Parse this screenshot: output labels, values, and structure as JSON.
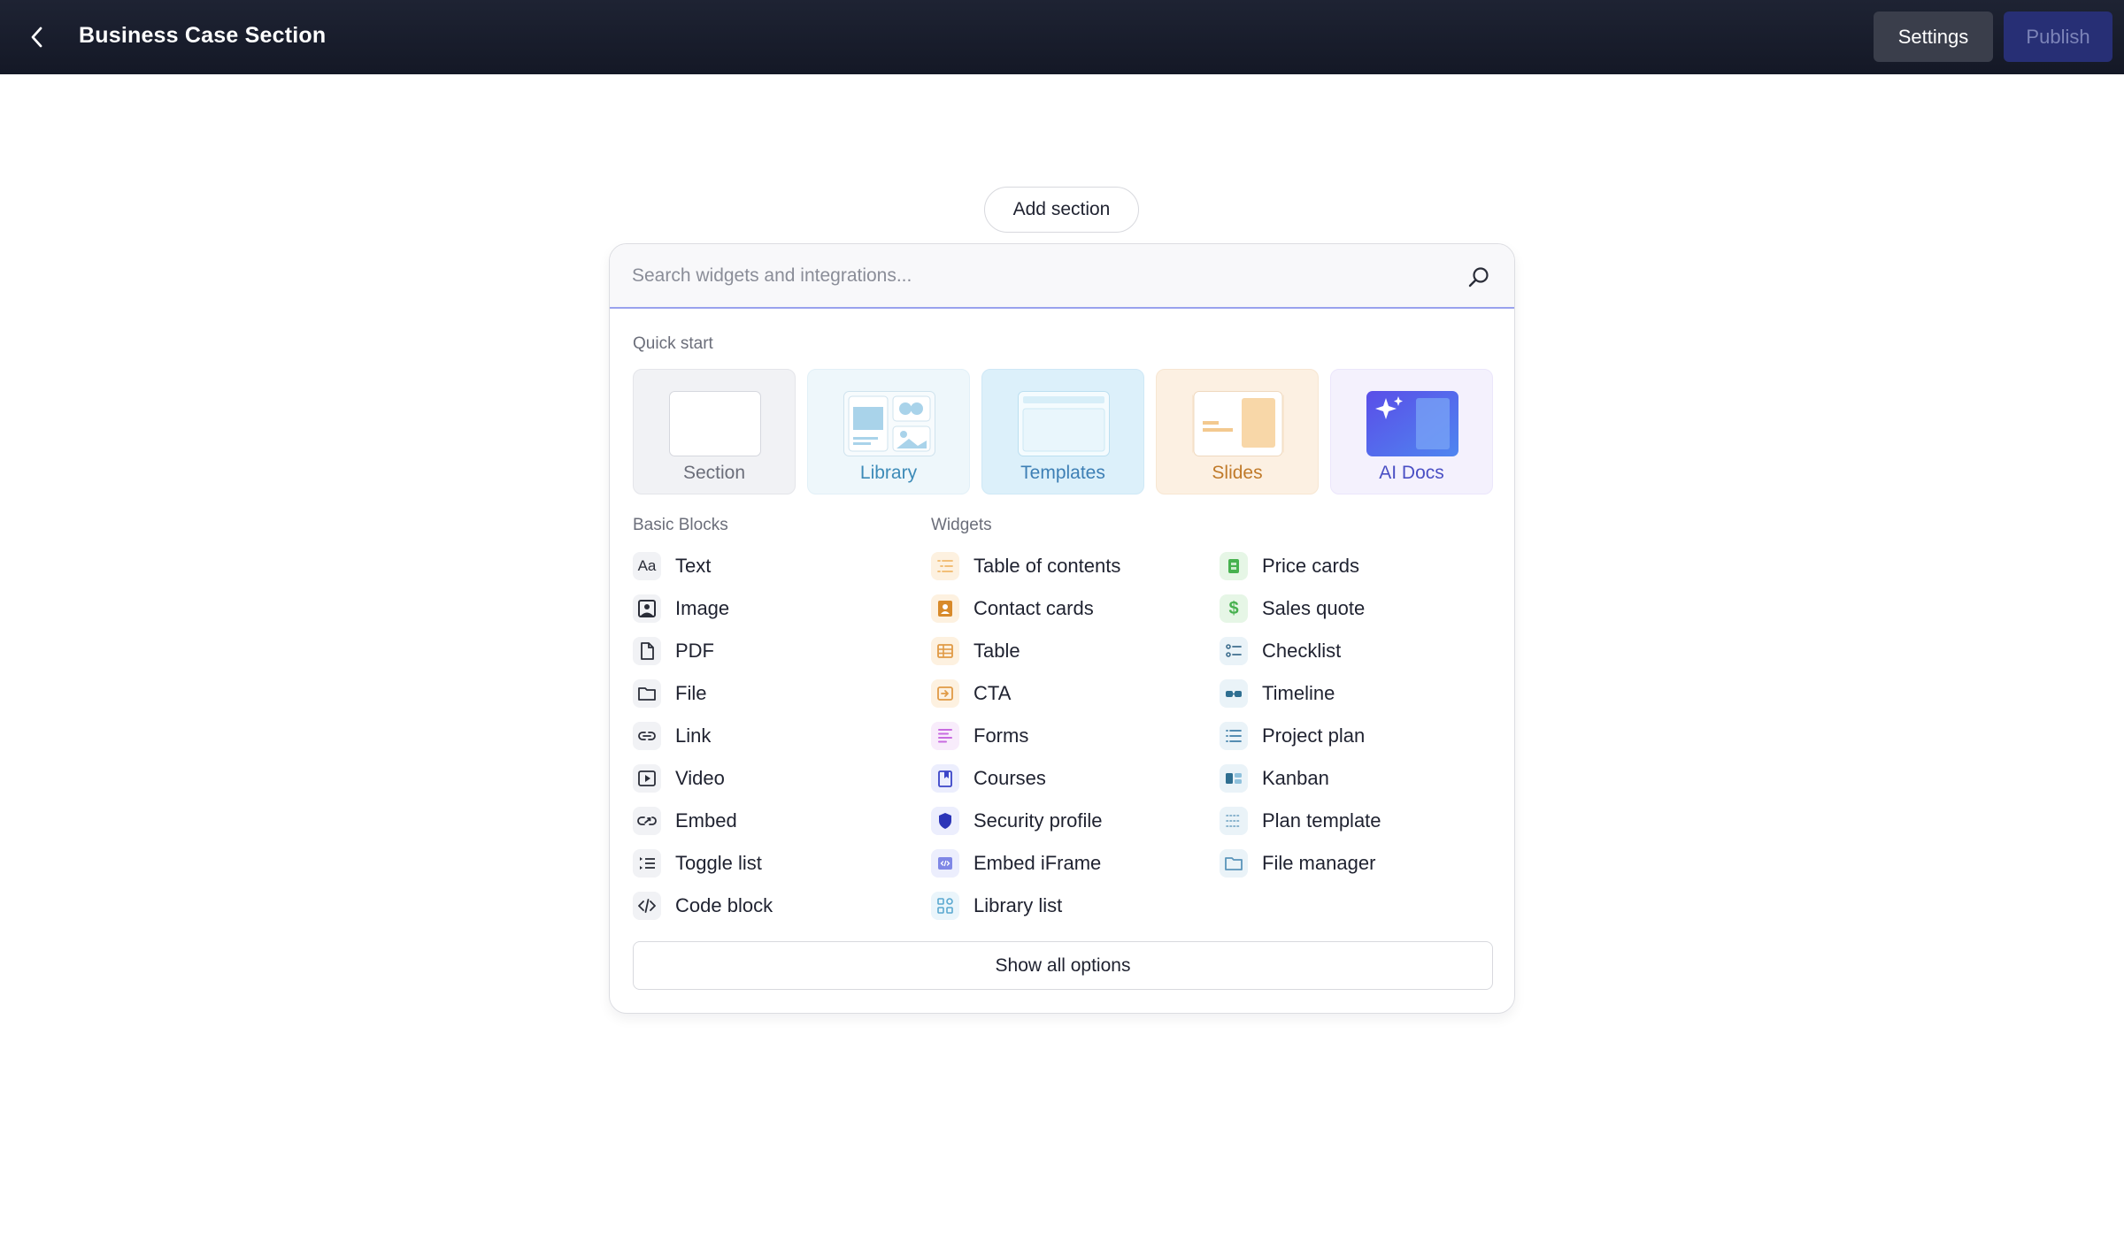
{
  "header": {
    "title": "Business Case Section",
    "settings_label": "Settings",
    "publish_label": "Publish"
  },
  "add_section_label": "Add section",
  "search": {
    "placeholder": "Search widgets and integrations..."
  },
  "quick_start": {
    "label": "Quick start",
    "cards": [
      {
        "label": "Section",
        "color": "#6b6e7a"
      },
      {
        "label": "Library",
        "color": "#3d8bb8"
      },
      {
        "label": "Templates",
        "color": "#3d7fb5"
      },
      {
        "label": "Slides",
        "color": "#c07a2a"
      },
      {
        "label": "AI Docs",
        "color": "#4a4fc4"
      }
    ]
  },
  "basic_blocks": {
    "label": "Basic Blocks",
    "items": [
      {
        "label": "Text",
        "icon": "text-icon"
      },
      {
        "label": "Image",
        "icon": "image-icon"
      },
      {
        "label": "PDF",
        "icon": "pdf-icon"
      },
      {
        "label": "File",
        "icon": "folder-icon"
      },
      {
        "label": "Link",
        "icon": "link-icon"
      },
      {
        "label": "Video",
        "icon": "video-icon"
      },
      {
        "label": "Embed",
        "icon": "embed-icon"
      },
      {
        "label": "Toggle list",
        "icon": "toggle-list-icon"
      },
      {
        "label": "Code block",
        "icon": "code-icon"
      }
    ]
  },
  "widgets": {
    "label": "Widgets",
    "col1": [
      {
        "label": "Table of contents",
        "icon": "table-of-contents-icon"
      },
      {
        "label": "Contact cards",
        "icon": "contact-card-icon"
      },
      {
        "label": "Table",
        "icon": "table-icon"
      },
      {
        "label": "CTA",
        "icon": "cta-icon"
      },
      {
        "label": "Forms",
        "icon": "forms-icon"
      },
      {
        "label": "Courses",
        "icon": "courses-icon"
      },
      {
        "label": "Security profile",
        "icon": "shield-icon"
      },
      {
        "label": "Embed iFrame",
        "icon": "iframe-icon"
      },
      {
        "label": "Library list",
        "icon": "library-list-icon"
      }
    ],
    "col2": [
      {
        "label": "Price cards",
        "icon": "price-card-icon"
      },
      {
        "label": "Sales quote",
        "icon": "dollar-icon"
      },
      {
        "label": "Checklist",
        "icon": "checklist-icon"
      },
      {
        "label": "Timeline",
        "icon": "timeline-icon"
      },
      {
        "label": "Project plan",
        "icon": "project-plan-icon"
      },
      {
        "label": "Kanban",
        "icon": "kanban-icon"
      },
      {
        "label": "Plan template",
        "icon": "plan-template-icon"
      },
      {
        "label": "File manager",
        "icon": "folder-icon"
      }
    ]
  },
  "show_all_label": "Show all options"
}
